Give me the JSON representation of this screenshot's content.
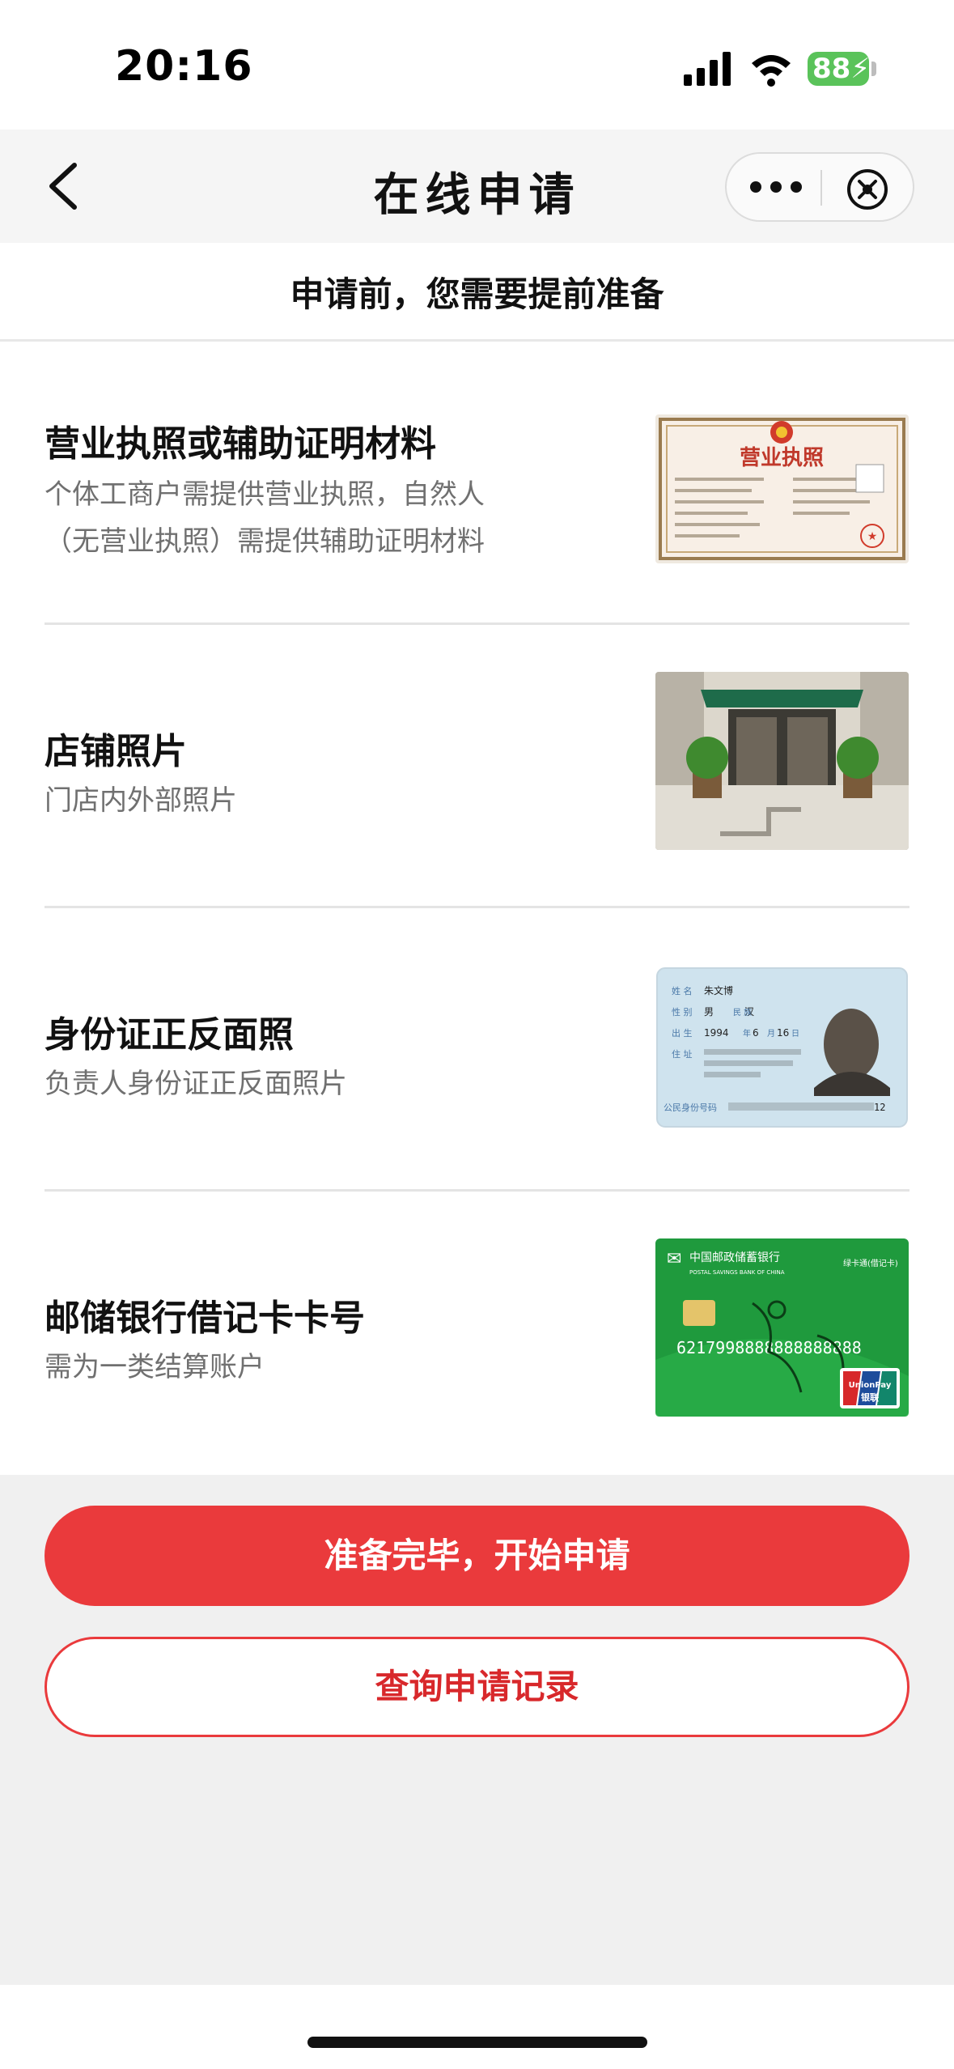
{
  "status_bar": {
    "time": "20:16",
    "battery": "88"
  },
  "nav": {
    "title": "在线申请"
  },
  "subtitle": "申请前，您需要提前准备",
  "items": [
    {
      "title": "营业执照或辅助证明材料",
      "desc_line1": "个体工商户需提供营业执照，自然人",
      "desc_line2": "（无营业执照）需提供辅助证明材料",
      "image_label": "营业执照"
    },
    {
      "title": "店铺照片",
      "desc_line1": "门店内外部照片"
    },
    {
      "title": "身份证正反面照",
      "desc_line1": "负责人身份证正反面照片",
      "id_name": "朱文博",
      "id_gender": "男",
      "id_ethnic": "汉",
      "id_year": "1994",
      "id_month": "6",
      "id_day": "16",
      "id_number_tail": "12"
    },
    {
      "title": "邮储银行借记卡卡号",
      "desc_line1": "需为一类结算账户",
      "card_bank": "中国邮政储蓄银行",
      "card_bank_en": "POSTAL SAVINGS BANK OF CHINA",
      "card_type": "绿卡通(借记卡)",
      "card_number": "6217998888888888888",
      "card_unionpay": "UnionPay",
      "card_unionpay_cn": "银联"
    }
  ],
  "buttons": {
    "primary": "准备完毕，开始申请",
    "secondary": "查询申请记录"
  },
  "colors": {
    "accent": "#ea3a3c",
    "battery": "#5ac35a"
  }
}
